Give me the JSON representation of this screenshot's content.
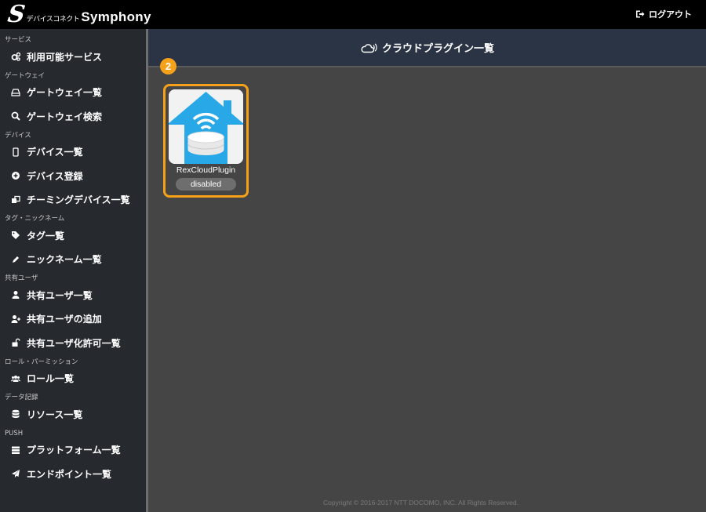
{
  "app": {
    "logo_jp": "デバイスコネクト",
    "logo_en": "Symphony",
    "logout_label": "ログアウト"
  },
  "sidebar": {
    "sections": [
      {
        "title": "サービス",
        "items": [
          {
            "label": "利用可能サービス",
            "icon": "cogs-icon"
          }
        ]
      },
      {
        "title": "ゲートウェイ",
        "items": [
          {
            "label": "ゲートウェイ一覧",
            "icon": "drive-icon"
          },
          {
            "label": "ゲートウェイ検索",
            "icon": "search-icon"
          }
        ]
      },
      {
        "title": "デバイス",
        "items": [
          {
            "label": "デバイス一覧",
            "icon": "mobile-icon"
          },
          {
            "label": "デバイス登録",
            "icon": "plus-circle-icon"
          },
          {
            "label": "チーミングデバイス一覧",
            "icon": "clone-icon"
          }
        ]
      },
      {
        "title": "タグ・ニックネーム",
        "items": [
          {
            "label": "タグ一覧",
            "icon": "tags-icon"
          },
          {
            "label": "ニックネーム一覧",
            "icon": "pencil-icon"
          }
        ]
      },
      {
        "title": "共有ユーザ",
        "items": [
          {
            "label": "共有ユーザ一覧",
            "icon": "user-icon"
          },
          {
            "label": "共有ユーザの追加",
            "icon": "user-plus-icon"
          },
          {
            "label": "共有ユーザ化許可一覧",
            "icon": "unlock-icon"
          }
        ]
      },
      {
        "title": "ロール・パーミッション",
        "items": [
          {
            "label": "ロール一覧",
            "icon": "users-icon"
          }
        ]
      },
      {
        "title": "データ記録",
        "items": [
          {
            "label": "リソース一覧",
            "icon": "database-icon"
          }
        ]
      },
      {
        "title": "PUSH",
        "items": [
          {
            "label": "プラットフォーム一覧",
            "icon": "server-icon"
          },
          {
            "label": "エンドポイント一覧",
            "icon": "paper-plane-icon"
          }
        ]
      }
    ]
  },
  "header": {
    "title": "クラウドプラグイン一覧",
    "icon": "cloud-icon"
  },
  "plugin": {
    "badge": "2",
    "name": "RexCloudPlugin",
    "status": "disabled",
    "highlight_color": "#f5a21a"
  },
  "footer": {
    "copyright": "Copyright © 2016-2017 NTT DOCOMO, INC. All Rights Reserved."
  }
}
